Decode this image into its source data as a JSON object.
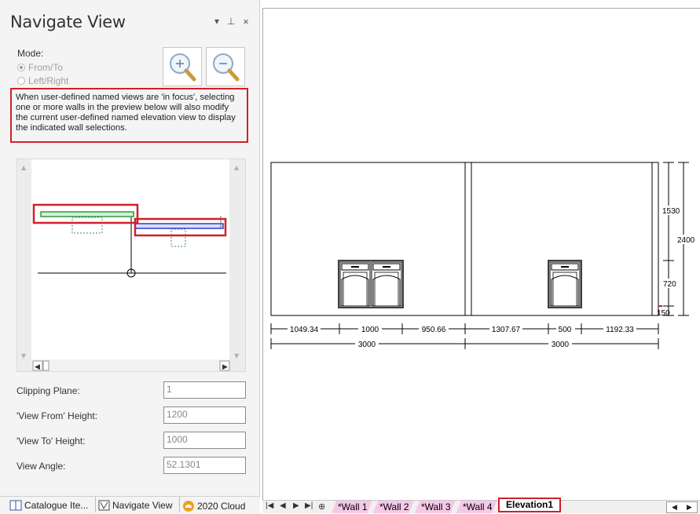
{
  "panel": {
    "title": "Navigate View",
    "mode_label": "Mode:",
    "mode_options": [
      "From/To",
      "Left/Right"
    ],
    "mode_selected": "From/To",
    "info_text": "When user-defined named views are 'in focus', selecting one or more walls in the preview below will also modify the current user-defined named elevation view to display the indicated wall selections.",
    "fields": [
      {
        "label": "Clipping Plane:",
        "value": "1"
      },
      {
        "label": "'View From' Height:",
        "value": "1200"
      },
      {
        "label": "'View To' Height:",
        "value": "1000"
      },
      {
        "label": "View Angle:",
        "value": "52.1301"
      }
    ]
  },
  "bottom_tabs": [
    "Catalogue Ite...",
    "Navigate View",
    "2020 Cloud"
  ],
  "sheet_tabs": [
    "*Wall 1",
    "*Wall 2",
    "*Wall 3",
    "*Wall 4",
    "Elevation1"
  ],
  "active_sheet": "Elevation1",
  "elevation": {
    "dims_row1": [
      "1049.34",
      "1000",
      "950.66",
      "1307.67",
      "500",
      "1192.33"
    ],
    "dims_row2": [
      "3000",
      "3000"
    ],
    "vertical_dims": [
      "1530",
      "2400",
      "720",
      "150"
    ]
  },
  "colors": {
    "highlight": "#d0202a",
    "selected_wall_green": "#2e9a3a",
    "selected_wall_blue": "#2b3ed6",
    "tab_pink": "#f5c8e8"
  }
}
